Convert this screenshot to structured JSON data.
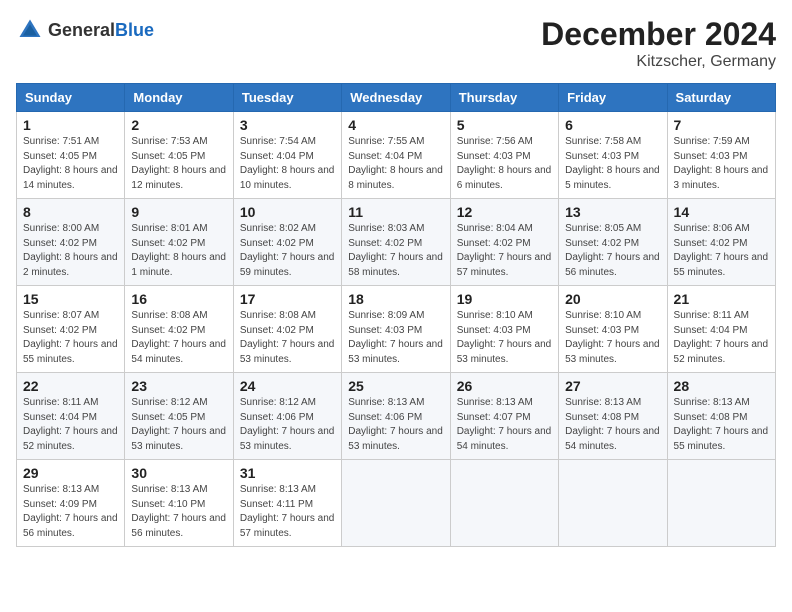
{
  "logo": {
    "text_general": "General",
    "text_blue": "Blue"
  },
  "title": {
    "month": "December 2024",
    "location": "Kitzscher, Germany"
  },
  "headers": [
    "Sunday",
    "Monday",
    "Tuesday",
    "Wednesday",
    "Thursday",
    "Friday",
    "Saturday"
  ],
  "weeks": [
    [
      {
        "day": "1",
        "info": "Sunrise: 7:51 AM\nSunset: 4:05 PM\nDaylight: 8 hours and 14 minutes."
      },
      {
        "day": "2",
        "info": "Sunrise: 7:53 AM\nSunset: 4:05 PM\nDaylight: 8 hours and 12 minutes."
      },
      {
        "day": "3",
        "info": "Sunrise: 7:54 AM\nSunset: 4:04 PM\nDaylight: 8 hours and 10 minutes."
      },
      {
        "day": "4",
        "info": "Sunrise: 7:55 AM\nSunset: 4:04 PM\nDaylight: 8 hours and 8 minutes."
      },
      {
        "day": "5",
        "info": "Sunrise: 7:56 AM\nSunset: 4:03 PM\nDaylight: 8 hours and 6 minutes."
      },
      {
        "day": "6",
        "info": "Sunrise: 7:58 AM\nSunset: 4:03 PM\nDaylight: 8 hours and 5 minutes."
      },
      {
        "day": "7",
        "info": "Sunrise: 7:59 AM\nSunset: 4:03 PM\nDaylight: 8 hours and 3 minutes."
      }
    ],
    [
      {
        "day": "8",
        "info": "Sunrise: 8:00 AM\nSunset: 4:02 PM\nDaylight: 8 hours and 2 minutes."
      },
      {
        "day": "9",
        "info": "Sunrise: 8:01 AM\nSunset: 4:02 PM\nDaylight: 8 hours and 1 minute."
      },
      {
        "day": "10",
        "info": "Sunrise: 8:02 AM\nSunset: 4:02 PM\nDaylight: 7 hours and 59 minutes."
      },
      {
        "day": "11",
        "info": "Sunrise: 8:03 AM\nSunset: 4:02 PM\nDaylight: 7 hours and 58 minutes."
      },
      {
        "day": "12",
        "info": "Sunrise: 8:04 AM\nSunset: 4:02 PM\nDaylight: 7 hours and 57 minutes."
      },
      {
        "day": "13",
        "info": "Sunrise: 8:05 AM\nSunset: 4:02 PM\nDaylight: 7 hours and 56 minutes."
      },
      {
        "day": "14",
        "info": "Sunrise: 8:06 AM\nSunset: 4:02 PM\nDaylight: 7 hours and 55 minutes."
      }
    ],
    [
      {
        "day": "15",
        "info": "Sunrise: 8:07 AM\nSunset: 4:02 PM\nDaylight: 7 hours and 55 minutes."
      },
      {
        "day": "16",
        "info": "Sunrise: 8:08 AM\nSunset: 4:02 PM\nDaylight: 7 hours and 54 minutes."
      },
      {
        "day": "17",
        "info": "Sunrise: 8:08 AM\nSunset: 4:02 PM\nDaylight: 7 hours and 53 minutes."
      },
      {
        "day": "18",
        "info": "Sunrise: 8:09 AM\nSunset: 4:03 PM\nDaylight: 7 hours and 53 minutes."
      },
      {
        "day": "19",
        "info": "Sunrise: 8:10 AM\nSunset: 4:03 PM\nDaylight: 7 hours and 53 minutes."
      },
      {
        "day": "20",
        "info": "Sunrise: 8:10 AM\nSunset: 4:03 PM\nDaylight: 7 hours and 53 minutes."
      },
      {
        "day": "21",
        "info": "Sunrise: 8:11 AM\nSunset: 4:04 PM\nDaylight: 7 hours and 52 minutes."
      }
    ],
    [
      {
        "day": "22",
        "info": "Sunrise: 8:11 AM\nSunset: 4:04 PM\nDaylight: 7 hours and 52 minutes."
      },
      {
        "day": "23",
        "info": "Sunrise: 8:12 AM\nSunset: 4:05 PM\nDaylight: 7 hours and 53 minutes."
      },
      {
        "day": "24",
        "info": "Sunrise: 8:12 AM\nSunset: 4:06 PM\nDaylight: 7 hours and 53 minutes."
      },
      {
        "day": "25",
        "info": "Sunrise: 8:13 AM\nSunset: 4:06 PM\nDaylight: 7 hours and 53 minutes."
      },
      {
        "day": "26",
        "info": "Sunrise: 8:13 AM\nSunset: 4:07 PM\nDaylight: 7 hours and 54 minutes."
      },
      {
        "day": "27",
        "info": "Sunrise: 8:13 AM\nSunset: 4:08 PM\nDaylight: 7 hours and 54 minutes."
      },
      {
        "day": "28",
        "info": "Sunrise: 8:13 AM\nSunset: 4:08 PM\nDaylight: 7 hours and 55 minutes."
      }
    ],
    [
      {
        "day": "29",
        "info": "Sunrise: 8:13 AM\nSunset: 4:09 PM\nDaylight: 7 hours and 56 minutes."
      },
      {
        "day": "30",
        "info": "Sunrise: 8:13 AM\nSunset: 4:10 PM\nDaylight: 7 hours and 56 minutes."
      },
      {
        "day": "31",
        "info": "Sunrise: 8:13 AM\nSunset: 4:11 PM\nDaylight: 7 hours and 57 minutes."
      },
      null,
      null,
      null,
      null
    ]
  ]
}
